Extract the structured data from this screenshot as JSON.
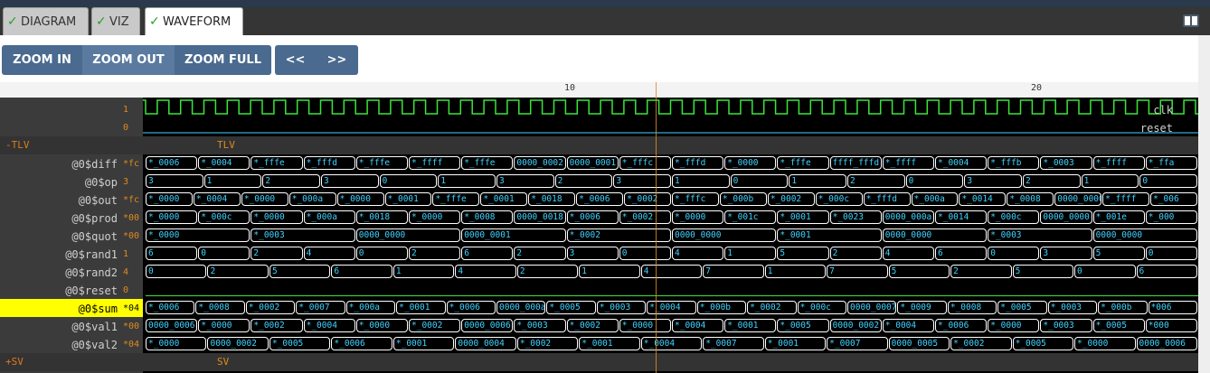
{
  "tabs": [
    {
      "label": "DIAGRAM",
      "checked": true
    },
    {
      "label": "VIZ",
      "checked": true
    },
    {
      "label": "WAVEFORM",
      "checked": true,
      "active": true
    }
  ],
  "toolbar": {
    "zoom_in": "ZOOM IN",
    "zoom_out": "ZOOM OUT",
    "zoom_full": "ZOOM FULL",
    "prev": "<<",
    "next": ">>"
  },
  "ruler": {
    "labels": [
      "10",
      "20"
    ]
  },
  "colors": {
    "clock": "#39e639",
    "value_text": "#3fd3ff",
    "marker": "#e08a1e",
    "highlight": "#ffff00"
  },
  "signals_top": [
    {
      "name": "clk",
      "value": "1"
    },
    {
      "name": "reset",
      "value": "0"
    }
  ],
  "group_tlv": {
    "toggle": "-",
    "name": "TLV",
    "label": "TLV"
  },
  "group_sv": {
    "toggle": "+",
    "name": "SV",
    "label": "SV"
  },
  "signals": [
    {
      "name": "@0$diff",
      "value": "*fc",
      "cells": [
        "*_0006",
        "*_0004",
        "*_fffe",
        "*_fffd",
        "*_fffe",
        "*_ffff",
        "*_fffe",
        "0000_0002",
        "0000_0001",
        "*_fffc",
        "*_fffd",
        "*_0000",
        "*_fffe",
        "ffff_fffd",
        "*_ffff",
        "*_0004",
        "*_fffb",
        "*_0003",
        "*_ffff",
        "*_ffa"
      ]
    },
    {
      "name": "@0$op",
      "value": "3",
      "cells": [
        "3",
        "1",
        "2",
        "3",
        "0",
        "1",
        "3",
        "2",
        "3",
        "1",
        "0",
        "1",
        "2",
        "0",
        "3",
        "2",
        "1",
        "0"
      ]
    },
    {
      "name": "@0$out",
      "value": "*fc",
      "cells": [
        "*_0000",
        "*_0004",
        "*_0000",
        "*_000a",
        "*_0000",
        "*_0001",
        "*_fffe",
        "*_0001",
        "*_0018",
        "*_0006",
        "*_0002",
        "*_fffc",
        "*_000b",
        "*_0002",
        "*_000c",
        "*_fffd",
        "*_000a",
        "*_0014",
        "*_0008",
        "0000_0000",
        "*_ffff",
        "*_006"
      ]
    },
    {
      "name": "@0$prod",
      "value": "*00",
      "cells": [
        "*_0000",
        "*_000c",
        "*_0000",
        "*_000a",
        "*_0018",
        "*_0000",
        "*_0008",
        "0000_0018",
        "*_0006",
        "*_0002",
        "*_0000",
        "*_001c",
        "*_0001",
        "*_0023",
        "0000_000a",
        "*_0014",
        "*_000c",
        "0000_0000",
        "*_001e",
        "*_000"
      ]
    },
    {
      "name": "@0$quot",
      "value": "*00",
      "cells": [
        "*_0000",
        "*_0003",
        "0000_0000",
        "0000_0001",
        "*_0002",
        "0000_0000",
        "*_0001",
        "0000_0000",
        "*_0003",
        "0000_0000"
      ]
    },
    {
      "name": "@0$rand1",
      "value": "1",
      "cells": [
        "6",
        "0",
        "2",
        "4",
        "0",
        "2",
        "6",
        "2",
        "3",
        "0",
        "4",
        "1",
        "5",
        "2",
        "4",
        "6",
        "0",
        "3",
        "5",
        "0"
      ]
    },
    {
      "name": "@0$rand2",
      "value": "4",
      "cells": [
        "0",
        "2",
        "5",
        "6",
        "1",
        "4",
        "2",
        "1",
        "4",
        "7",
        "1",
        "7",
        "5",
        "2",
        "5",
        "0",
        "6"
      ]
    },
    {
      "name": "@0$reset",
      "value": "0",
      "cells": []
    },
    {
      "name": "@0$sum",
      "value": "*04",
      "highlight": true,
      "cells": [
        "*_0006",
        "*_0008",
        "*_0002",
        "*_0007",
        "*_000a",
        "*_0001",
        "*_0006",
        "0000_000a",
        "*_0005",
        "*_0003",
        "*_0004",
        "*_000b",
        "*_0002",
        "*_000c",
        "0000_0007",
        "*_0009",
        "*_0008",
        "*_0005",
        "*_0003",
        "*_000b",
        "*006"
      ]
    },
    {
      "name": "@0$val1",
      "value": "*00",
      "cells": [
        "0000_0006",
        "*_0000",
        "*_0002",
        "*_0004",
        "*_0000",
        "*_0002",
        "0000_0006",
        "*_0003",
        "*_0002",
        "*_0000",
        "*_0004",
        "*_0001",
        "*_0005",
        "0000_0002",
        "*_0004",
        "*_0006",
        "*_0000",
        "*_0003",
        "*_0005",
        "*000"
      ]
    },
    {
      "name": "@0$val2",
      "value": "*04",
      "cells": [
        "*_0000",
        "0000_0002",
        "*_0005",
        "*_0006",
        "*_0001",
        "0000_0004",
        "*_0002",
        "*_0001",
        "*_0004",
        "*_0007",
        "*_0001",
        "*_0007",
        "0000_0005",
        "*_0002",
        "*_0005",
        "*_0000",
        "0000_0006"
      ]
    }
  ]
}
